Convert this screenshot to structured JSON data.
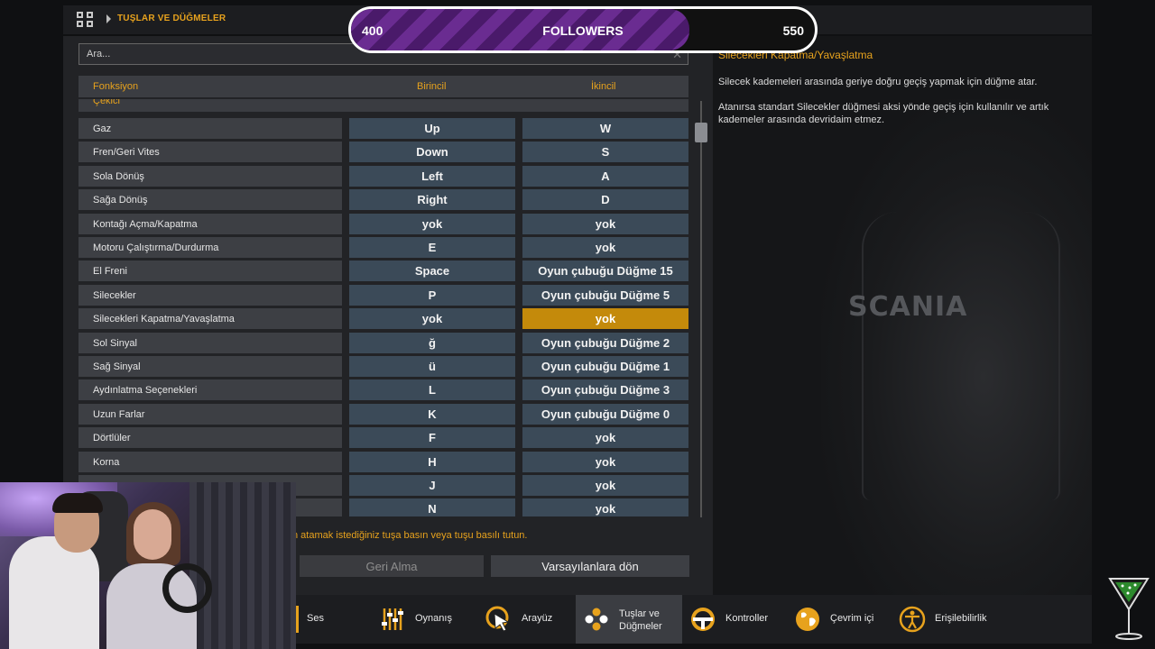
{
  "breadcrumb": {
    "title": "TUŞLAR VE DÜĞMELER"
  },
  "followers": {
    "current": "400",
    "label": "FOLLOWERS",
    "goal": "550",
    "progress": 0.73
  },
  "search": {
    "placeholder": "Ara..."
  },
  "table": {
    "headers": {
      "function": "Fonksiyon",
      "primary": "Birincil",
      "secondary": "İkincil"
    },
    "section": "Çekici",
    "rows": [
      {
        "fn": "Gaz",
        "primary": "Up",
        "secondary": "W"
      },
      {
        "fn": "Fren/Geri Vites",
        "primary": "Down",
        "secondary": "S"
      },
      {
        "fn": "Sola Dönüş",
        "primary": "Left",
        "secondary": "A"
      },
      {
        "fn": "Sağa Dönüş",
        "primary": "Right",
        "secondary": "D"
      },
      {
        "fn": "Kontağı Açma/Kapatma",
        "primary": "yok",
        "secondary": "yok"
      },
      {
        "fn": "Motoru Çalıştırma/Durdurma",
        "primary": "E",
        "secondary": "yok"
      },
      {
        "fn": "El Freni",
        "primary": "Space",
        "secondary": "Oyun çubuğu Düğme 15"
      },
      {
        "fn": "Silecekler",
        "primary": "P",
        "secondary": "Oyun çubuğu Düğme 5"
      },
      {
        "fn": "Silecekleri Kapatma/Yavaşlatma",
        "primary": "yok",
        "secondary": "yok",
        "selected": true
      },
      {
        "fn": "Sol Sinyal",
        "primary": "ğ",
        "secondary": "Oyun çubuğu Düğme 2"
      },
      {
        "fn": "Sağ Sinyal",
        "primary": "ü",
        "secondary": "Oyun çubuğu Düğme 1"
      },
      {
        "fn": "Aydınlatma Seçenekleri",
        "primary": "L",
        "secondary": "Oyun çubuğu Düğme 3"
      },
      {
        "fn": "Uzun Farlar",
        "primary": "K",
        "secondary": "Oyun çubuğu Düğme 0"
      },
      {
        "fn": "Dörtlüler",
        "primary": "F",
        "secondary": "yok"
      },
      {
        "fn": "Korna",
        "primary": "H",
        "secondary": "yok"
      },
      {
        "fn": "",
        "primary": "J",
        "secondary": "yok"
      },
      {
        "fn": "",
        "primary": "N",
        "secondary": "yok"
      }
    ]
  },
  "hint": "n atamak istediğiniz tuşa basın veya tuşu basılı tutun.",
  "buttons": {
    "undo": "Geri Alma",
    "defaults": "Varsayılanlara dön"
  },
  "description": {
    "title": "Silecekleri Kapatma/Yavaşlatma",
    "p1": "Silecek kademeleri arasında geriye doğru geçiş yapmak için düğme atar.",
    "p2": "Atanırsa standart Silecekler düğmesi aksi yönde geçiş için kullanılır ve artık kademeler arasında devridaim etmez."
  },
  "background_brand": "SCANIA",
  "nav": [
    {
      "label": "Ses",
      "icon": "speaker-icon"
    },
    {
      "label": "Oynanış",
      "icon": "sliders-icon"
    },
    {
      "label": "Arayüz",
      "icon": "cursor-icon"
    },
    {
      "label": "Tuşlar ve Düğmeler",
      "icon": "buttons-icon",
      "active": true
    },
    {
      "label": "Kontroller",
      "icon": "steering-wheel-icon"
    },
    {
      "label": "Çevrim içi",
      "icon": "globe-icon"
    },
    {
      "label": "Erişilebilirlik",
      "icon": "accessibility-icon"
    }
  ],
  "colors": {
    "accent": "#e7a21d",
    "selected_cell": "#c48a0b",
    "key_cell": "#3b4a58",
    "followers_fill": "#6a2c91"
  }
}
